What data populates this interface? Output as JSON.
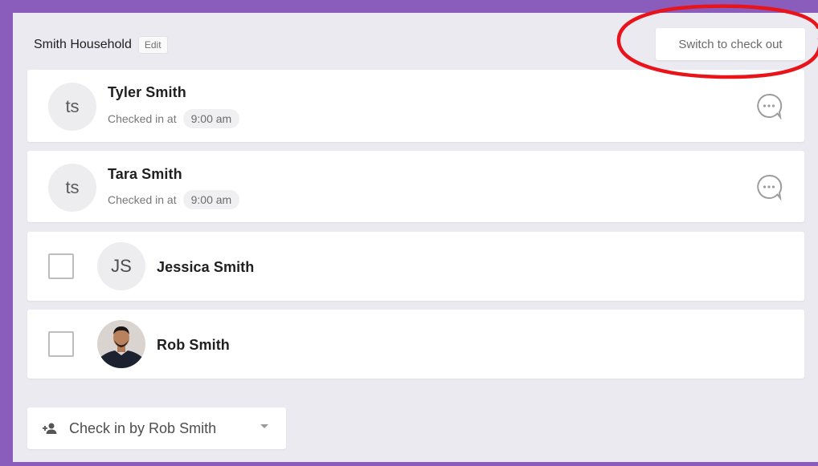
{
  "household": {
    "name": "Smith Household",
    "edit_label": "Edit"
  },
  "switch_button": {
    "label": "Switch to check out"
  },
  "checked_in": [
    {
      "initials": "ts",
      "name": "Tyler Smith",
      "status": "Checked in at",
      "time": "9:00 am"
    },
    {
      "initials": "ts",
      "name": "Tara Smith",
      "status": "Checked in at",
      "time": "9:00 am"
    }
  ],
  "not_checked_in": [
    {
      "initials": "JS",
      "name": "Jessica Smith",
      "checked": false
    },
    {
      "initials": "",
      "name": "Rob Smith",
      "checked": false,
      "avatar": "photo"
    }
  ],
  "checkin_by": {
    "label": "Check in by Rob Smith",
    "icon": "person-add-icon"
  },
  "annotation": {
    "color": "#e8141a",
    "shape": "ellipse"
  },
  "colors": {
    "frame": "#8a5cbc",
    "panel": "#eceaf1"
  }
}
